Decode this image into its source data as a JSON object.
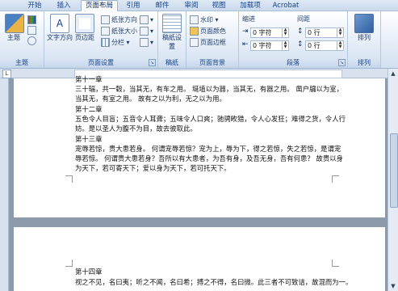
{
  "tabs": [
    "开始",
    "插入",
    "页面布局",
    "引用",
    "邮件",
    "审阅",
    "视图",
    "加载项",
    "Acrobat"
  ],
  "active_tab": "页面布局",
  "ribbon": {
    "themes": {
      "label": "主题",
      "big": "主题"
    },
    "page_setup": {
      "label": "页面设置",
      "text_direction": "文字方向",
      "margins": "页边距",
      "orientation": "纸张方向",
      "size": "纸张大小",
      "columns": "分栏"
    },
    "paper": {
      "label": "稿纸",
      "button": "稿纸设置"
    },
    "page_background": {
      "label": "页面背景",
      "watermark": "水印",
      "page_color": "页面颜色",
      "page_border": "页面边框"
    },
    "paragraph": {
      "label": "段落",
      "indent": "缩进",
      "spacing": "间距",
      "left_value": "0 字符",
      "right_value": "0 字符",
      "before_value": "0 行",
      "after_value": "0 行"
    },
    "arrange": {
      "label": "排列",
      "button": "排列"
    }
  },
  "document": {
    "page1_lines": [
      "第十一章",
      "三十辐，共一毂，当其无，有车之用。 埏埴以为器，当其无，有器之用。 凿户牖以为室，",
      "当其无，有室之用。 故有之以为利，无之以为用。",
      "第十二章",
      "五色令人目盲；五音令人耳聋；五味令人口爽；驰骋畋猎，令人心发狂；难得之货，令人行",
      "妨。是以圣人为腹不为目，故去彼取此。",
      "第十三章",
      "宠辱若惊，贵大患若身。 何谓宠辱若惊？宠为上，辱为下，得之若惊，失之若惊，是谓宠",
      "辱若惊。 何谓贵大患若身？吾所以有大患者，为吾有身，及吾无身，吾有何患？ 故贵以身",
      "为天下，若可寄天下；爱以身为天下，若可托天下。"
    ],
    "page2_lines": [
      "第十四章",
      "视之不见，名曰夷；听之不闻，名曰希；搏之不得，名曰微。此三者不可致诘，故混而为一。"
    ]
  },
  "colors": {
    "accent": "#15428b",
    "ribbon_bg": "#e6eef8",
    "doc_bg": "#8d9aab"
  }
}
